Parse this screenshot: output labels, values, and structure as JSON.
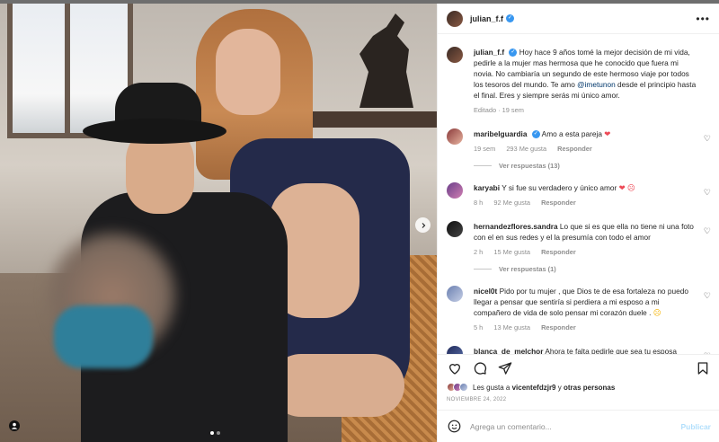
{
  "post": {
    "username": "julian_f.f",
    "more_label": "•••",
    "verified_glyph": "✓"
  },
  "caption": {
    "username": "julian_f.f",
    "text_before_mention": "Hoy hace 9 años tomé la mejor decisión de mi vida, pedirle a la mujer mas hermosa que he conocido que fuera mi novia. No cambiaría un segundo de este hermoso viaje por todos los tesoros del mundo. Te amo ",
    "mention": "@imetunon",
    "text_after_mention": " desde el principio hasta el final. Eres y siempre serás mi único amor.",
    "meta": "Editado · 19 sem"
  },
  "comments": [
    {
      "username": "maribelguardia",
      "verified": true,
      "text": "Amo a esta pareja ",
      "emoji": "❤",
      "time": "19 sem",
      "likes": "293 Me gusta",
      "reply": "Responder"
    },
    {
      "username": "karyabi",
      "text": "Y si fue su verdadero y único amor ",
      "emoji": "❤ ☹",
      "time": "8 h",
      "likes": "92 Me gusta",
      "reply": "Responder"
    },
    {
      "username": "hernandezflores.sandra",
      "text": "Lo que si es que ella no tiene ni una foto con el en sus redes y el la presumía con todo el amor",
      "time": "2 h",
      "likes": "15 Me gusta",
      "reply": "Responder"
    },
    {
      "username": "nicel0t",
      "text": "Pido por tu mujer , que Dios te de esa fortaleza no puedo llegar a pensar que sentiría si perdiera a mi esposo a mi compañero de vida de solo pensar mi corazón duele . ",
      "emoji": "☹",
      "time": "5 h",
      "likes": "13 Me gusta",
      "reply": "Responder"
    },
    {
      "username": "blanca_de_melchor",
      "text": "Ahora te falta pedirle que sea tu esposa"
    }
  ],
  "replies": {
    "first": "Ver respuestas (13)",
    "second": "Ver respuestas (1)"
  },
  "likes": {
    "prefix": "Les gusta a ",
    "user": "vicentefdzjr9",
    "middle": " y ",
    "others": "otras personas"
  },
  "date": "NOVIEMBRE 24, 2022",
  "composer": {
    "placeholder": "Agrega un comentario...",
    "post_label": "Publicar"
  },
  "colors": {
    "verified": "#3897f0",
    "mention": "#00376b",
    "post_button": "#b2dffc",
    "heart": "#ed4956"
  },
  "icons": [
    "user-tag-icon",
    "next-arrow-icon",
    "more-icon",
    "heart-icon",
    "comment-icon",
    "share-icon",
    "bookmark-icon",
    "emoji-icon",
    "verified-icon"
  ]
}
